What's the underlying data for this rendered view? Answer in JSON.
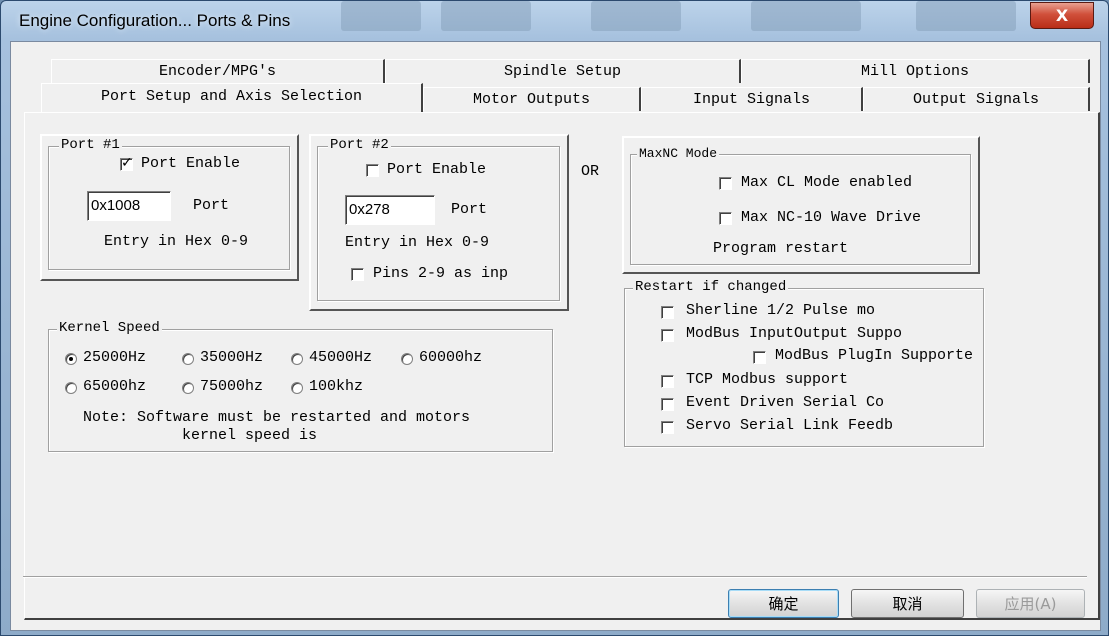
{
  "window": {
    "title": "Engine Configuration... Ports & Pins",
    "close_symbol": "X"
  },
  "tabs": {
    "row1": [
      "Encoder/MPG's",
      "Spindle Setup",
      "Mill Options"
    ],
    "row2": [
      "Port Setup and Axis Selection",
      "Motor Outputs",
      "Input Signals",
      "Output Signals"
    ]
  },
  "port1": {
    "legend": "Port #1",
    "enable_label": "Port Enable",
    "enable_checked": true,
    "address": "0x1008",
    "address_label": "Port",
    "hex_note": "Entry in Hex 0-9"
  },
  "port2": {
    "legend": "Port #2",
    "enable_label": "Port Enable",
    "enable_checked": false,
    "address": "0x278",
    "address_label": "Port",
    "hex_note": "Entry in Hex 0-9",
    "pins_label": "Pins 2-9 as inp"
  },
  "or_label": "OR",
  "maxnc": {
    "legend": "MaxNC Mode",
    "options": [
      "Max CL Mode enabled",
      "Max NC-10 Wave Drive"
    ],
    "note": "Program restart"
  },
  "restart": {
    "legend": "Restart if changed",
    "options": [
      "Sherline 1/2 Pulse mo",
      "ModBus InputOutput Suppo",
      "ModBus PlugIn Supporte",
      "TCP Modbus support",
      "Event Driven Serial Co",
      "Servo Serial Link Feedb"
    ]
  },
  "kernel": {
    "legend": "Kernel Speed",
    "speeds": [
      "25000Hz",
      "35000Hz",
      "45000Hz",
      "60000hz",
      "65000hz",
      "75000hz",
      "100khz"
    ],
    "selected": "25000Hz",
    "note_line1": "Note: Software must be restarted and motors",
    "note_line2": "kernel speed is"
  },
  "buttons": {
    "ok": "确定",
    "cancel": "取消",
    "apply": "应用(A)"
  }
}
